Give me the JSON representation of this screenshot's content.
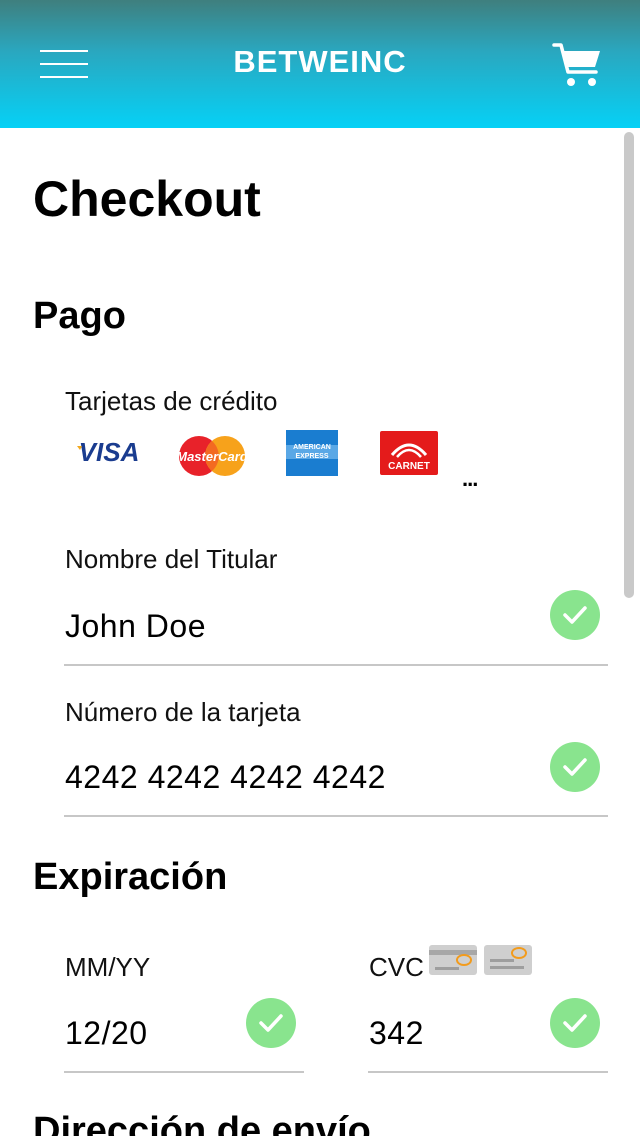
{
  "header": {
    "brand": "BETWEINC",
    "menu_icon": "hamburger-menu-icon",
    "cart_icon": "shopping-cart-icon",
    "gradient_top": "#3f7f7e",
    "gradient_bottom": "#06d1f6"
  },
  "page": {
    "title": "Checkout"
  },
  "payment": {
    "section_title": "Pago",
    "cards_label": "Tarjetas de crédito",
    "card_brands": [
      "VISA",
      "MasterCard",
      "AMERICAN EXPRESS",
      "CARNET"
    ],
    "more": "..."
  },
  "holder": {
    "label": "Nombre del Titular",
    "value": "John Doe",
    "valid": true
  },
  "card_number": {
    "label": "Número de la tarjeta",
    "value": "4242 4242 4242 4242",
    "valid": true
  },
  "expiration": {
    "section_title": "Expiración",
    "mmyy_label": "MM/YY",
    "mmyy_value": "12/20",
    "cvc_label": "CVC",
    "cvc_value": "342"
  },
  "shipping": {
    "section_title": "Dirección de envío"
  },
  "colors": {
    "check": "#89e48e",
    "line": "#c7c7c7"
  }
}
